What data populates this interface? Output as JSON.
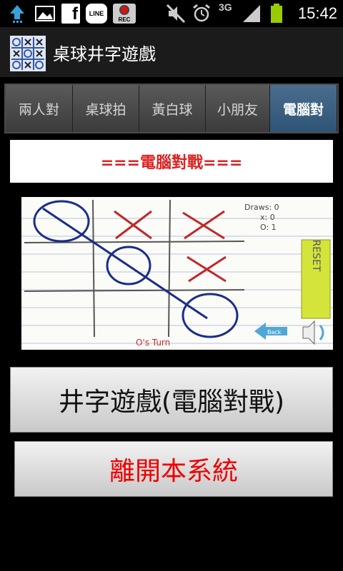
{
  "status_bar": {
    "time": "15:42",
    "network": "3G",
    "icons": [
      "upload-icon",
      "gallery-icon",
      "facebook-icon",
      "line-icon",
      "rec-icon",
      "mute-icon",
      "alarm-icon",
      "signal-icon",
      "battery-icon"
    ],
    "line_label": "LINE",
    "rec_label": "REC",
    "facebook_label": "f"
  },
  "app": {
    "title": "桌球井字遊戲"
  },
  "tabs": [
    {
      "label": "兩人對"
    },
    {
      "label": "桌球拍"
    },
    {
      "label": "黃白球"
    },
    {
      "label": "小朋友"
    },
    {
      "label": "電腦對"
    }
  ],
  "banner": {
    "text": "===電腦對戰==="
  },
  "game": {
    "draws_label": "Draws: 0",
    "x_label": "x: 0",
    "o_label": "O: 1",
    "reset_label": "RESET",
    "back_label": "Back",
    "turn_label": "O's Turn"
  },
  "buttons": {
    "play_label": "井字遊戲(電腦對戰)",
    "exit_label": "離開本系統"
  },
  "colors": {
    "accent_tab": "#2f5476",
    "banner_text": "#dd2222",
    "exit_text": "#ee0000"
  }
}
